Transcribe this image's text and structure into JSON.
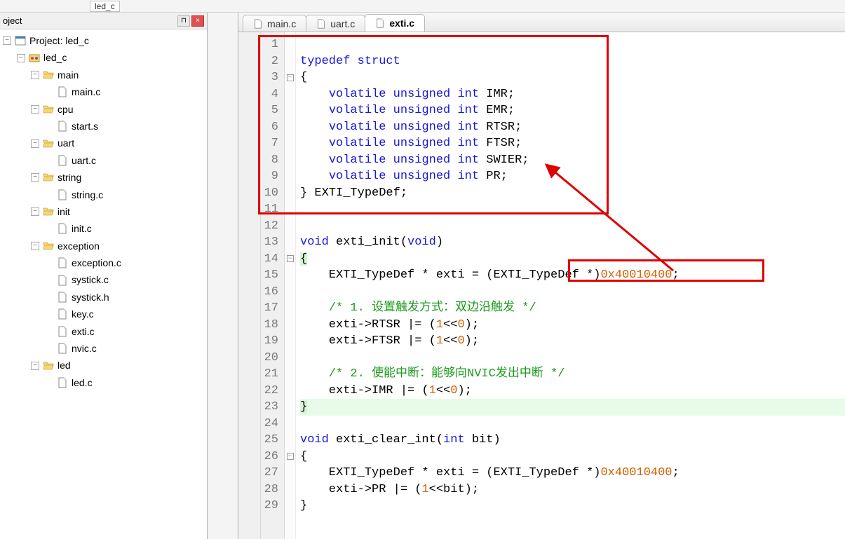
{
  "toolbar": {
    "detached_tab": "led_c"
  },
  "panel": {
    "title": "oject",
    "pin": "⊓",
    "close": "×"
  },
  "tree": {
    "root_label": "Project: led_c",
    "groups": [
      {
        "name": "led_c",
        "type": "target",
        "items": []
      },
      {
        "name": "main",
        "type": "folder",
        "items": [
          "main.c"
        ]
      },
      {
        "name": "cpu",
        "type": "folder",
        "items": [
          "start.s"
        ]
      },
      {
        "name": "uart",
        "type": "folder",
        "items": [
          "uart.c"
        ]
      },
      {
        "name": "string",
        "type": "folder",
        "items": [
          "string.c"
        ]
      },
      {
        "name": "init",
        "type": "folder",
        "items": [
          "init.c"
        ]
      },
      {
        "name": "exception",
        "type": "folder",
        "items": [
          "exception.c",
          "systick.c",
          "systick.h",
          "key.c",
          "exti.c",
          "nvic.c"
        ]
      },
      {
        "name": "led",
        "type": "folder",
        "items": [
          "led.c"
        ]
      }
    ]
  },
  "tabs": [
    {
      "label": "main.c",
      "active": false
    },
    {
      "label": "uart.c",
      "active": false
    },
    {
      "label": "exti.c",
      "active": true
    }
  ],
  "code": {
    "lines": [
      {
        "n": 1,
        "fold": "",
        "html": ""
      },
      {
        "n": 2,
        "fold": "",
        "html": "<span class='kw'>typedef</span> <span class='kw'>struct</span>"
      },
      {
        "n": 3,
        "fold": "-",
        "html": "{"
      },
      {
        "n": 4,
        "fold": "",
        "html": "    <span class='kw'>volatile</span> <span class='kw'>unsigned</span> <span class='kw'>int</span> IMR;"
      },
      {
        "n": 5,
        "fold": "",
        "html": "    <span class='kw'>volatile</span> <span class='kw'>unsigned</span> <span class='kw'>int</span> EMR;"
      },
      {
        "n": 6,
        "fold": "",
        "html": "    <span class='kw'>volatile</span> <span class='kw'>unsigned</span> <span class='kw'>int</span> RTSR;"
      },
      {
        "n": 7,
        "fold": "",
        "html": "    <span class='kw'>volatile</span> <span class='kw'>unsigned</span> <span class='kw'>int</span> FTSR;"
      },
      {
        "n": 8,
        "fold": "",
        "html": "    <span class='kw'>volatile</span> <span class='kw'>unsigned</span> <span class='kw'>int</span> SWIER;"
      },
      {
        "n": 9,
        "fold": "",
        "html": "    <span class='kw'>volatile</span> <span class='kw'>unsigned</span> <span class='kw'>int</span> PR;"
      },
      {
        "n": 10,
        "fold": "",
        "html": "} EXTI_TypeDef;"
      },
      {
        "n": 11,
        "fold": "",
        "html": ""
      },
      {
        "n": 12,
        "fold": "",
        "html": ""
      },
      {
        "n": 13,
        "fold": "",
        "html": "<span class='kw'>void</span> exti_init(<span class='kw'>void</span>)"
      },
      {
        "n": 14,
        "fold": "-",
        "html": "<span class='br-h'>{</span>"
      },
      {
        "n": 15,
        "fold": "",
        "html": "    EXTI_TypeDef * exti = (EXTI_TypeDef *)<span class='num'>0x40010400</span>;"
      },
      {
        "n": 16,
        "fold": "",
        "html": ""
      },
      {
        "n": 17,
        "fold": "",
        "html": "    <span class='cm'>/* 1. 设置触发方式：双边沿触发 */</span>"
      },
      {
        "n": 18,
        "fold": "",
        "html": "    exti-&gt;RTSR |= (<span class='num'>1</span>&lt;&lt;<span class='num'>0</span>);"
      },
      {
        "n": 19,
        "fold": "",
        "html": "    exti-&gt;FTSR |= (<span class='num'>1</span>&lt;&lt;<span class='num'>0</span>);"
      },
      {
        "n": 20,
        "fold": "",
        "html": ""
      },
      {
        "n": 21,
        "fold": "",
        "html": "    <span class='cm'>/* 2. 使能中断：能够向NVIC发出中断 */</span>"
      },
      {
        "n": 22,
        "fold": "",
        "html": "    exti-&gt;IMR |= (<span class='num'>1</span>&lt;&lt;<span class='num'>0</span>);"
      },
      {
        "n": 23,
        "fold": "",
        "html": "<span class='br-h'>}</span>",
        "hl": true
      },
      {
        "n": 24,
        "fold": "",
        "html": ""
      },
      {
        "n": 25,
        "fold": "",
        "html": "<span class='kw'>void</span> exti_clear_int(<span class='kw'>int</span> bit)"
      },
      {
        "n": 26,
        "fold": "-",
        "html": "{"
      },
      {
        "n": 27,
        "fold": "",
        "html": "    EXTI_TypeDef * exti = (EXTI_TypeDef *)<span class='num'>0x40010400</span>;"
      },
      {
        "n": 28,
        "fold": "",
        "html": "    exti-&gt;PR |= (<span class='num'>1</span>&lt;&lt;bit);"
      },
      {
        "n": 29,
        "fold": "",
        "html": "}"
      }
    ]
  }
}
